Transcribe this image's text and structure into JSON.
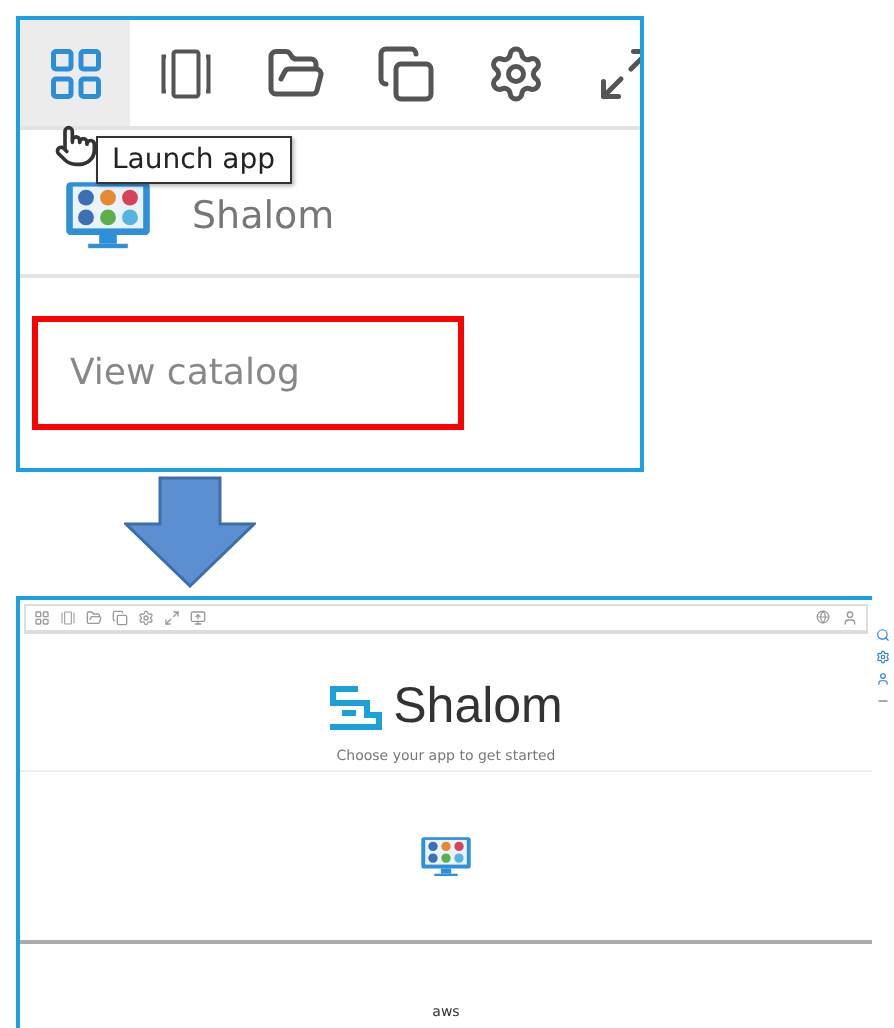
{
  "top_panel": {
    "toolbar": [
      {
        "kind": "grid",
        "selected": true
      },
      {
        "kind": "panels",
        "selected": false
      },
      {
        "kind": "folder",
        "selected": false
      },
      {
        "kind": "copy",
        "selected": false
      },
      {
        "kind": "settings",
        "selected": false
      },
      {
        "kind": "expand",
        "selected": false
      }
    ],
    "tooltip": "Launch app",
    "app": {
      "name": "Shalom"
    },
    "catalog_link": "View catalog"
  },
  "bottom_screenshot": {
    "toolbar": [
      {
        "kind": "grid"
      },
      {
        "kind": "panels"
      },
      {
        "kind": "folder"
      },
      {
        "kind": "copy"
      },
      {
        "kind": "settings"
      },
      {
        "kind": "expand"
      },
      {
        "kind": "display"
      }
    ],
    "logo": "Shalom",
    "subtitle": "Choose your app to get started",
    "footer_brand": "aws"
  }
}
